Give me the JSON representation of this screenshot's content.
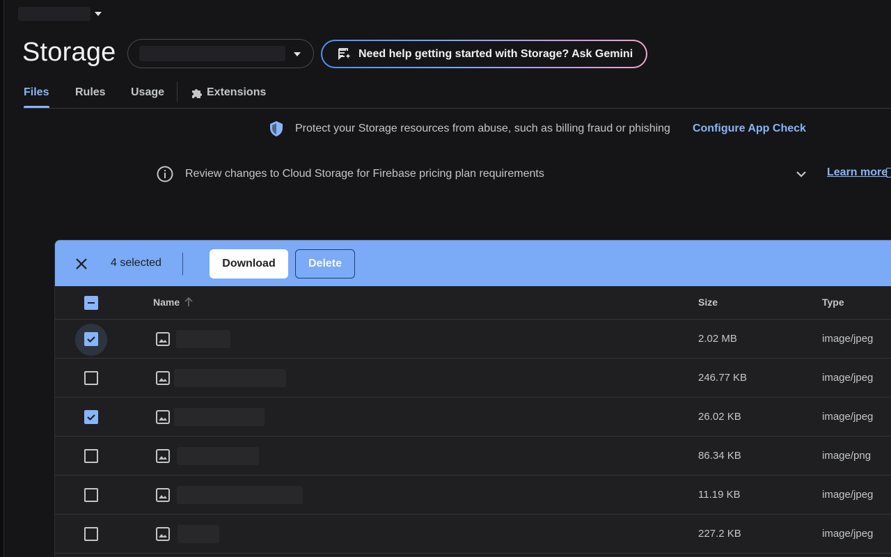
{
  "header": {
    "title": "Storage",
    "gemini_button_label": "Need help getting started with Storage? Ask Gemini"
  },
  "tabs": [
    {
      "label": "Files",
      "active": true
    },
    {
      "label": "Rules",
      "active": false
    },
    {
      "label": "Usage",
      "active": false
    },
    {
      "label": "Extensions",
      "active": false
    }
  ],
  "banners": {
    "app_check_text": "Protect your Storage resources from abuse, such as billing fraud or phishing",
    "app_check_link": "Configure App Check",
    "pricing_text": "Review changes to Cloud Storage for Firebase pricing plan requirements",
    "learn_more_link": "Learn more"
  },
  "selection_bar": {
    "count_label": "4 selected",
    "download_label": "Download",
    "delete_label": "Delete"
  },
  "table": {
    "columns": {
      "name": "Name",
      "size": "Size",
      "type": "Type"
    },
    "rows": [
      {
        "size": "2.02 MB",
        "type": "image/jpeg",
        "checked": true
      },
      {
        "size": "246.77 KB",
        "type": "image/jpeg",
        "checked": false
      },
      {
        "size": "26.02 KB",
        "type": "image/jpeg",
        "checked": true
      },
      {
        "size": "86.34 KB",
        "type": "image/png",
        "checked": false
      },
      {
        "size": "11.19 KB",
        "type": "image/jpeg",
        "checked": false
      },
      {
        "size": "227.2 KB",
        "type": "image/jpeg",
        "checked": false
      }
    ]
  },
  "colors": {
    "accent": "#8ab4f8",
    "selection_bar": "#7baaf7",
    "background": "#151517"
  }
}
